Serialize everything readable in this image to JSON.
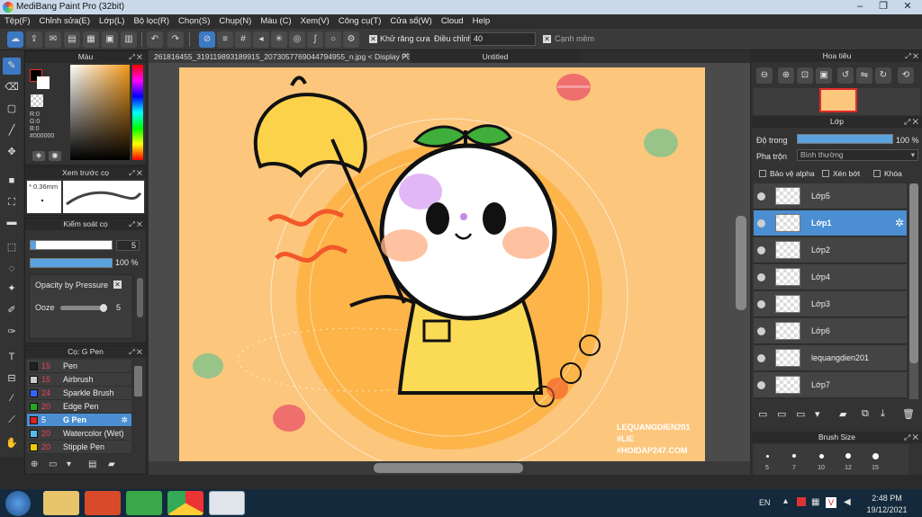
{
  "window": {
    "title": "MediBang Paint Pro (32bit)"
  },
  "menu": [
    "Tệp(F)",
    "Chỉnh sửa(E)",
    "Lớp(L)",
    "Bộ lọc(R)",
    "Chọn(S)",
    "Chụp(N)",
    "Màu (C)",
    "Xem(V)",
    "Công cụ(T)",
    "Cửa sổ(W)",
    "Cloud",
    "Help"
  ],
  "toolbar": {
    "antialias_label": "Khử răng cưa",
    "adjust_label": "Điều chỉnh",
    "adjust_value": "40",
    "snap_label": "Cạnh mềm"
  },
  "color_panel": {
    "title": "Màu",
    "r": "R:0",
    "g": "G:0",
    "b": "B:0",
    "hex": "#000000",
    "brush_preview_title": "Xem trước cọ",
    "brush_preview_size": "0.36mm"
  },
  "brush_control": {
    "title": "Kiểm soát cọ",
    "size": "5",
    "opacity": "100 %",
    "opacity_pressure": "Opacity by Pressure",
    "ooze_label": "Ooze",
    "ooze_value": "5"
  },
  "brush_list": {
    "title": "Cọ: G Pen",
    "items": [
      {
        "size": "15",
        "name": "Pen",
        "color": "#222222"
      },
      {
        "size": "15",
        "name": "Airbrush",
        "color": "#cccccc"
      },
      {
        "size": "24",
        "name": "Sparkle Brush",
        "color": "#3366ff"
      },
      {
        "size": "20",
        "name": "Edge Pen",
        "color": "#22aa22"
      },
      {
        "size": "5",
        "name": "G Pen",
        "color": "#dd2222",
        "selected": true
      },
      {
        "size": "20",
        "name": "Watercolor (Wet)",
        "color": "#55bbee"
      },
      {
        "size": "20",
        "name": "Stipple Pen",
        "color": "#eecc00"
      }
    ]
  },
  "tabs": {
    "file": "261816455_319119893189915_2073057769044794955_n.jpg < Display P3 >",
    "untitled": "Untitled"
  },
  "artwork": {
    "signature_line1": "LEQUANGDIEN201",
    "signature_line2": "#LIE",
    "signature_line3": "#HOIDAP247.COM"
  },
  "navigator": {
    "title": "Hoa tiêu"
  },
  "layers": {
    "title": "Lớp",
    "opacity_label": "Độ trong",
    "opacity_value": "100 %",
    "blend_label": "Pha trộn",
    "blend_value": "Bình thường",
    "protect_alpha": "Bảo vệ alpha",
    "clip": "Xén bớt",
    "lock": "Khóa",
    "items": [
      {
        "name": "Lớp5"
      },
      {
        "name": "Lớp1",
        "selected": true
      },
      {
        "name": "Lớp2"
      },
      {
        "name": "Lớp4"
      },
      {
        "name": "Lớp3"
      },
      {
        "name": "Lớp6"
      },
      {
        "name": "lequangdien201"
      },
      {
        "name": "Lớp7"
      }
    ]
  },
  "brush_size": {
    "title": "Brush Size",
    "sizes": [
      "5",
      "7",
      "10",
      "12",
      "15"
    ]
  },
  "taskbar": {
    "lang": "EN",
    "time": "2:48 PM",
    "date": "19/12/2021"
  }
}
